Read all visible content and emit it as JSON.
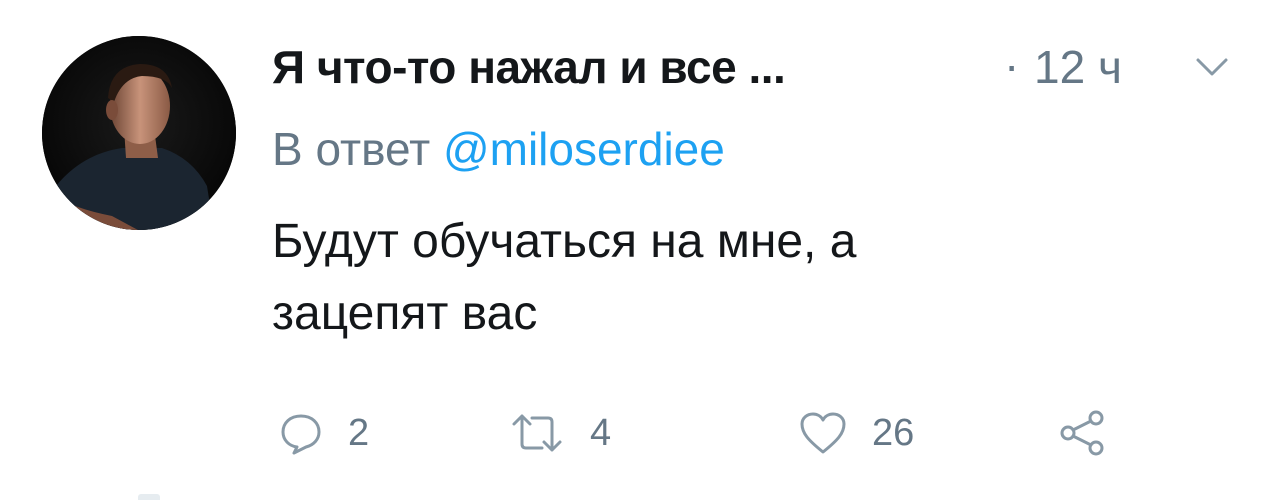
{
  "tweet": {
    "author_name": "Я что-то нажал и все ...",
    "separator": "·",
    "time": "12 ч",
    "reply_prefix": "В ответ",
    "reply_mention": "@miloserdiee",
    "text_line1": "Будут обучаться на мне, а",
    "text_line2": "зацепят вас"
  },
  "actions": {
    "reply_count": "2",
    "retweet_count": "4",
    "like_count": "26"
  },
  "icons": {
    "avatar": "avatar-photo",
    "caret": "chevron-down-icon",
    "reply": "reply-icon",
    "retweet": "retweet-icon",
    "like": "heart-icon",
    "share": "share-icon"
  },
  "colors": {
    "text": "#14171a",
    "muted": "#657786",
    "accent": "#1da1f2"
  }
}
